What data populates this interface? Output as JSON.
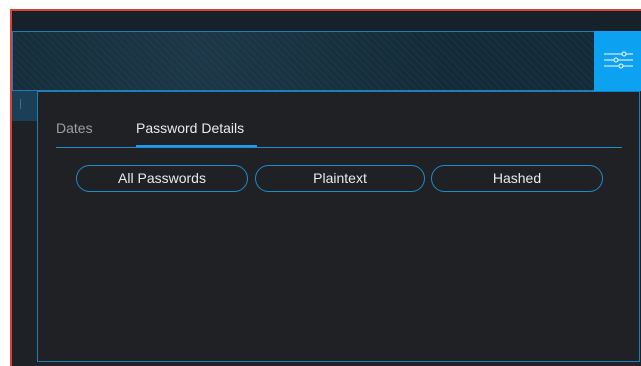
{
  "filter_button": {
    "icon": "sliders-icon"
  },
  "tabs": [
    {
      "label": "Dates",
      "active": false
    },
    {
      "label": "Password Details",
      "active": true
    }
  ],
  "filters": [
    {
      "label": "All Passwords"
    },
    {
      "label": "Plaintext"
    },
    {
      "label": "Hashed"
    }
  ],
  "colors": {
    "accent": "#0da1f2",
    "border_blue": "#1e7fb8",
    "window_edge": "#d3453a",
    "panel_bg": "#1f2124",
    "banner_bg": "#132b38",
    "text_active": "#e8eaed",
    "text_muted": "#9aa0a6"
  }
}
